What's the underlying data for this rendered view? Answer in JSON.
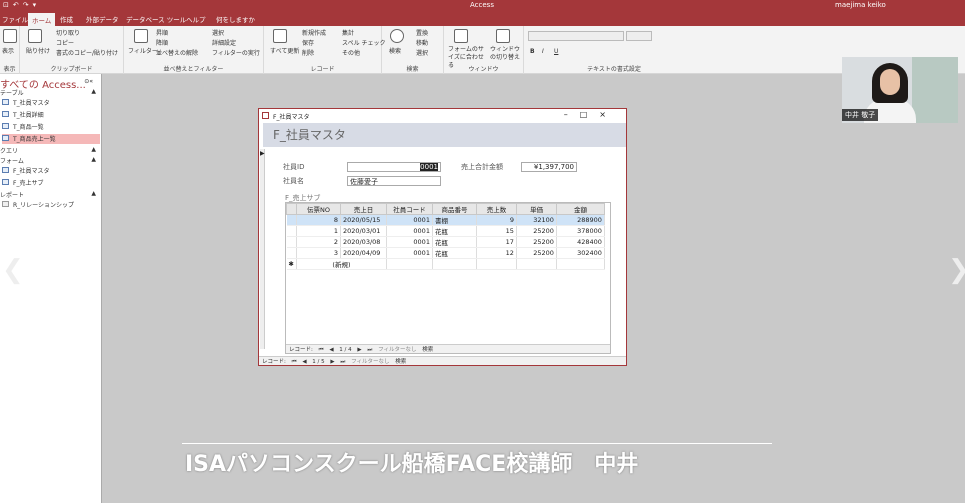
{
  "app": {
    "title": "Access",
    "user": "maejima keiko"
  },
  "ribbon_tabs": [
    "ファイル",
    "ホーム",
    "作成",
    "外部データ",
    "データベース ツール",
    "ヘルプ",
    "何をしますか"
  ],
  "ribbon": {
    "groups": [
      {
        "label": "表示",
        "items": [
          "表示"
        ]
      },
      {
        "label": "クリップボード",
        "items": [
          "貼り付け",
          "切り取り",
          "コピー",
          "書式のコピー/貼り付け"
        ]
      },
      {
        "label": "並べ替えとフィルター",
        "items": [
          "フィルター",
          "昇順",
          "降順",
          "並べ替えの解除",
          "選択",
          "詳細設定",
          "フィルターの実行"
        ]
      },
      {
        "label": "レコード",
        "items": [
          "すべて更新",
          "新規作成",
          "保存",
          "削除",
          "集計",
          "スペル チェック",
          "その他"
        ]
      },
      {
        "label": "検索",
        "items": [
          "検索",
          "置換",
          "移動",
          "選択"
        ]
      },
      {
        "label": "ウィンドウ",
        "items": [
          "フォームのサイズに合わせる",
          "ウィンドウの切り替え"
        ]
      },
      {
        "label": "テキストの書式設定",
        "items": [
          "B",
          "I",
          "U"
        ]
      }
    ]
  },
  "nav": {
    "title": "すべての Access...",
    "sections": [
      {
        "label": "テーブル",
        "items": [
          "T_社員マスタ",
          "T_社員詳細",
          "T_商品一覧",
          "T_商品売上一覧"
        ]
      },
      {
        "label": "クエリ",
        "items": []
      },
      {
        "label": "フォーム",
        "items": [
          "F_社員マスタ",
          "F_売上サブ"
        ]
      },
      {
        "label": "レポート",
        "items": [
          "R_リレーションシップ"
        ]
      }
    ]
  },
  "form": {
    "window_title": "F_社員マスタ",
    "header": "F_社員マスタ",
    "fields": {
      "emp_id_label": "社員ID",
      "emp_id_value": "0001",
      "emp_name_label": "社員名",
      "emp_name_value": "佐藤愛子",
      "total_label": "売上合計金額",
      "total_value": "¥1,397,700"
    },
    "subform_label": "F_売上サブ",
    "table": {
      "headers": [
        "伝票NO",
        "売上日",
        "社員コード",
        "商品番号",
        "売上数",
        "単価",
        "金額"
      ],
      "rows": [
        [
          "8",
          "2020/05/15",
          "0001",
          "書棚",
          "9",
          "32100",
          "288900"
        ],
        [
          "1",
          "2020/03/01",
          "0001",
          "花瓶",
          "15",
          "25200",
          "378000"
        ],
        [
          "2",
          "2020/03/08",
          "0001",
          "花瓶",
          "17",
          "25200",
          "428400"
        ],
        [
          "3",
          "2020/04/09",
          "0001",
          "花瓶",
          "12",
          "25200",
          "302400"
        ]
      ],
      "new_row": "(新規)"
    },
    "sub_nav": {
      "label": "レコード:",
      "pos": "1 / 4",
      "filter": "フィルターなし",
      "search": "検索"
    },
    "main_nav": {
      "label": "レコード:",
      "pos": "1 / 5",
      "filter": "フィルターなし",
      "search": "検索"
    }
  },
  "webcam": {
    "name": "中井 敬子"
  },
  "caption": "ISAパソコンスクール船橋FACE校講師　中井"
}
